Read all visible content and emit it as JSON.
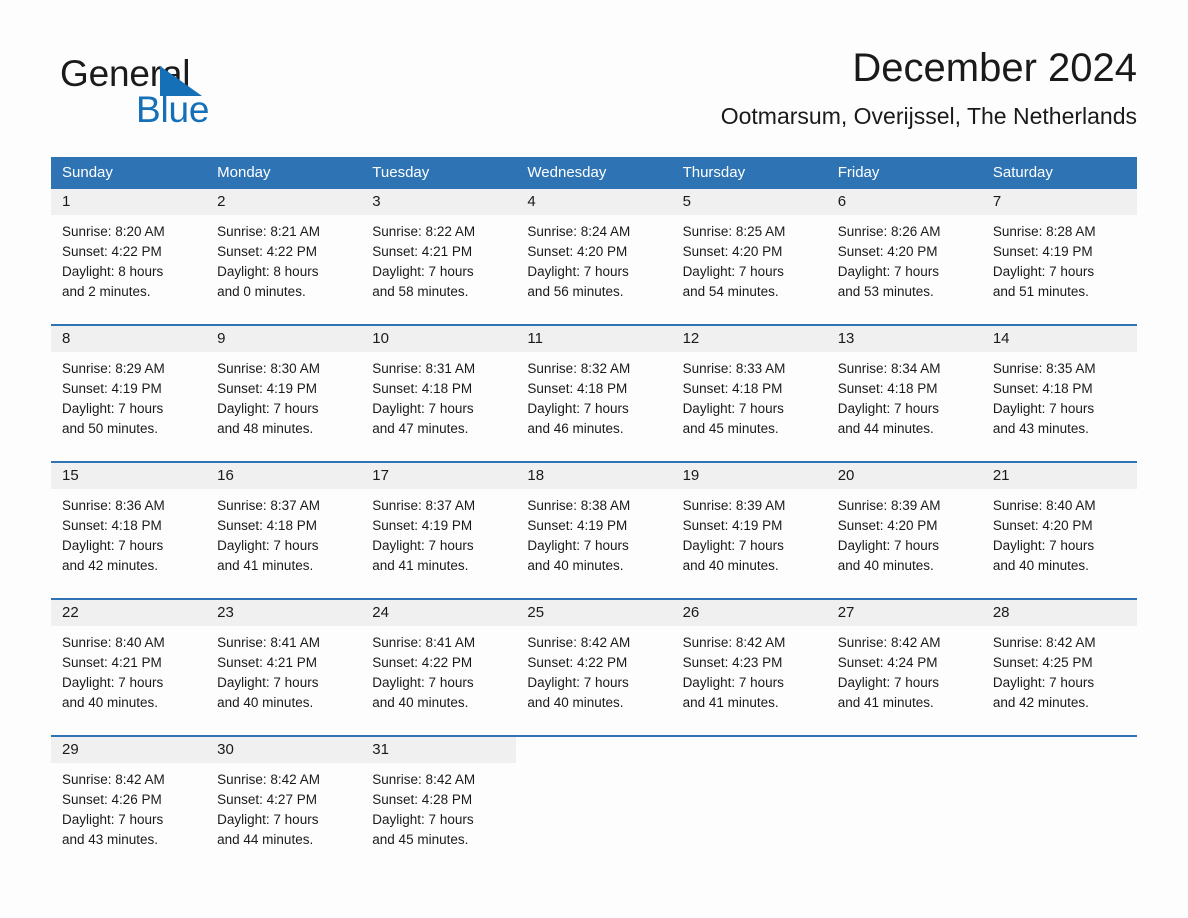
{
  "brand": {
    "word1": "General",
    "word2": "Blue",
    "triangle_color": "#1570b8"
  },
  "header": {
    "title": "December 2024",
    "subtitle": "Ootmarsum, Overijssel, The Netherlands"
  },
  "theme": {
    "header_blue": "#2e74b5",
    "daynum_band": "#f0f0f0",
    "page_background": "#fdfdfd"
  },
  "weekdays": [
    "Sunday",
    "Monday",
    "Tuesday",
    "Wednesday",
    "Thursday",
    "Friday",
    "Saturday"
  ],
  "weeks": [
    [
      {
        "day": "1",
        "sunrise": "Sunrise: 8:20 AM",
        "sunset": "Sunset: 4:22 PM",
        "daylight1": "Daylight: 8 hours",
        "daylight2": "and 2 minutes."
      },
      {
        "day": "2",
        "sunrise": "Sunrise: 8:21 AM",
        "sunset": "Sunset: 4:22 PM",
        "daylight1": "Daylight: 8 hours",
        "daylight2": "and 0 minutes."
      },
      {
        "day": "3",
        "sunrise": "Sunrise: 8:22 AM",
        "sunset": "Sunset: 4:21 PM",
        "daylight1": "Daylight: 7 hours",
        "daylight2": "and 58 minutes."
      },
      {
        "day": "4",
        "sunrise": "Sunrise: 8:24 AM",
        "sunset": "Sunset: 4:20 PM",
        "daylight1": "Daylight: 7 hours",
        "daylight2": "and 56 minutes."
      },
      {
        "day": "5",
        "sunrise": "Sunrise: 8:25 AM",
        "sunset": "Sunset: 4:20 PM",
        "daylight1": "Daylight: 7 hours",
        "daylight2": "and 54 minutes."
      },
      {
        "day": "6",
        "sunrise": "Sunrise: 8:26 AM",
        "sunset": "Sunset: 4:20 PM",
        "daylight1": "Daylight: 7 hours",
        "daylight2": "and 53 minutes."
      },
      {
        "day": "7",
        "sunrise": "Sunrise: 8:28 AM",
        "sunset": "Sunset: 4:19 PM",
        "daylight1": "Daylight: 7 hours",
        "daylight2": "and 51 minutes."
      }
    ],
    [
      {
        "day": "8",
        "sunrise": "Sunrise: 8:29 AM",
        "sunset": "Sunset: 4:19 PM",
        "daylight1": "Daylight: 7 hours",
        "daylight2": "and 50 minutes."
      },
      {
        "day": "9",
        "sunrise": "Sunrise: 8:30 AM",
        "sunset": "Sunset: 4:19 PM",
        "daylight1": "Daylight: 7 hours",
        "daylight2": "and 48 minutes."
      },
      {
        "day": "10",
        "sunrise": "Sunrise: 8:31 AM",
        "sunset": "Sunset: 4:18 PM",
        "daylight1": "Daylight: 7 hours",
        "daylight2": "and 47 minutes."
      },
      {
        "day": "11",
        "sunrise": "Sunrise: 8:32 AM",
        "sunset": "Sunset: 4:18 PM",
        "daylight1": "Daylight: 7 hours",
        "daylight2": "and 46 minutes."
      },
      {
        "day": "12",
        "sunrise": "Sunrise: 8:33 AM",
        "sunset": "Sunset: 4:18 PM",
        "daylight1": "Daylight: 7 hours",
        "daylight2": "and 45 minutes."
      },
      {
        "day": "13",
        "sunrise": "Sunrise: 8:34 AM",
        "sunset": "Sunset: 4:18 PM",
        "daylight1": "Daylight: 7 hours",
        "daylight2": "and 44 minutes."
      },
      {
        "day": "14",
        "sunrise": "Sunrise: 8:35 AM",
        "sunset": "Sunset: 4:18 PM",
        "daylight1": "Daylight: 7 hours",
        "daylight2": "and 43 minutes."
      }
    ],
    [
      {
        "day": "15",
        "sunrise": "Sunrise: 8:36 AM",
        "sunset": "Sunset: 4:18 PM",
        "daylight1": "Daylight: 7 hours",
        "daylight2": "and 42 minutes."
      },
      {
        "day": "16",
        "sunrise": "Sunrise: 8:37 AM",
        "sunset": "Sunset: 4:18 PM",
        "daylight1": "Daylight: 7 hours",
        "daylight2": "and 41 minutes."
      },
      {
        "day": "17",
        "sunrise": "Sunrise: 8:37 AM",
        "sunset": "Sunset: 4:19 PM",
        "daylight1": "Daylight: 7 hours",
        "daylight2": "and 41 minutes."
      },
      {
        "day": "18",
        "sunrise": "Sunrise: 8:38 AM",
        "sunset": "Sunset: 4:19 PM",
        "daylight1": "Daylight: 7 hours",
        "daylight2": "and 40 minutes."
      },
      {
        "day": "19",
        "sunrise": "Sunrise: 8:39 AM",
        "sunset": "Sunset: 4:19 PM",
        "daylight1": "Daylight: 7 hours",
        "daylight2": "and 40 minutes."
      },
      {
        "day": "20",
        "sunrise": "Sunrise: 8:39 AM",
        "sunset": "Sunset: 4:20 PM",
        "daylight1": "Daylight: 7 hours",
        "daylight2": "and 40 minutes."
      },
      {
        "day": "21",
        "sunrise": "Sunrise: 8:40 AM",
        "sunset": "Sunset: 4:20 PM",
        "daylight1": "Daylight: 7 hours",
        "daylight2": "and 40 minutes."
      }
    ],
    [
      {
        "day": "22",
        "sunrise": "Sunrise: 8:40 AM",
        "sunset": "Sunset: 4:21 PM",
        "daylight1": "Daylight: 7 hours",
        "daylight2": "and 40 minutes."
      },
      {
        "day": "23",
        "sunrise": "Sunrise: 8:41 AM",
        "sunset": "Sunset: 4:21 PM",
        "daylight1": "Daylight: 7 hours",
        "daylight2": "and 40 minutes."
      },
      {
        "day": "24",
        "sunrise": "Sunrise: 8:41 AM",
        "sunset": "Sunset: 4:22 PM",
        "daylight1": "Daylight: 7 hours",
        "daylight2": "and 40 minutes."
      },
      {
        "day": "25",
        "sunrise": "Sunrise: 8:42 AM",
        "sunset": "Sunset: 4:22 PM",
        "daylight1": "Daylight: 7 hours",
        "daylight2": "and 40 minutes."
      },
      {
        "day": "26",
        "sunrise": "Sunrise: 8:42 AM",
        "sunset": "Sunset: 4:23 PM",
        "daylight1": "Daylight: 7 hours",
        "daylight2": "and 41 minutes."
      },
      {
        "day": "27",
        "sunrise": "Sunrise: 8:42 AM",
        "sunset": "Sunset: 4:24 PM",
        "daylight1": "Daylight: 7 hours",
        "daylight2": "and 41 minutes."
      },
      {
        "day": "28",
        "sunrise": "Sunrise: 8:42 AM",
        "sunset": "Sunset: 4:25 PM",
        "daylight1": "Daylight: 7 hours",
        "daylight2": "and 42 minutes."
      }
    ],
    [
      {
        "day": "29",
        "sunrise": "Sunrise: 8:42 AM",
        "sunset": "Sunset: 4:26 PM",
        "daylight1": "Daylight: 7 hours",
        "daylight2": "and 43 minutes."
      },
      {
        "day": "30",
        "sunrise": "Sunrise: 8:42 AM",
        "sunset": "Sunset: 4:27 PM",
        "daylight1": "Daylight: 7 hours",
        "daylight2": "and 44 minutes."
      },
      {
        "day": "31",
        "sunrise": "Sunrise: 8:42 AM",
        "sunset": "Sunset: 4:28 PM",
        "daylight1": "Daylight: 7 hours",
        "daylight2": "and 45 minutes."
      },
      {
        "day": "",
        "sunrise": "",
        "sunset": "",
        "daylight1": "",
        "daylight2": ""
      },
      {
        "day": "",
        "sunrise": "",
        "sunset": "",
        "daylight1": "",
        "daylight2": ""
      },
      {
        "day": "",
        "sunrise": "",
        "sunset": "",
        "daylight1": "",
        "daylight2": ""
      },
      {
        "day": "",
        "sunrise": "",
        "sunset": "",
        "daylight1": "",
        "daylight2": ""
      }
    ]
  ]
}
